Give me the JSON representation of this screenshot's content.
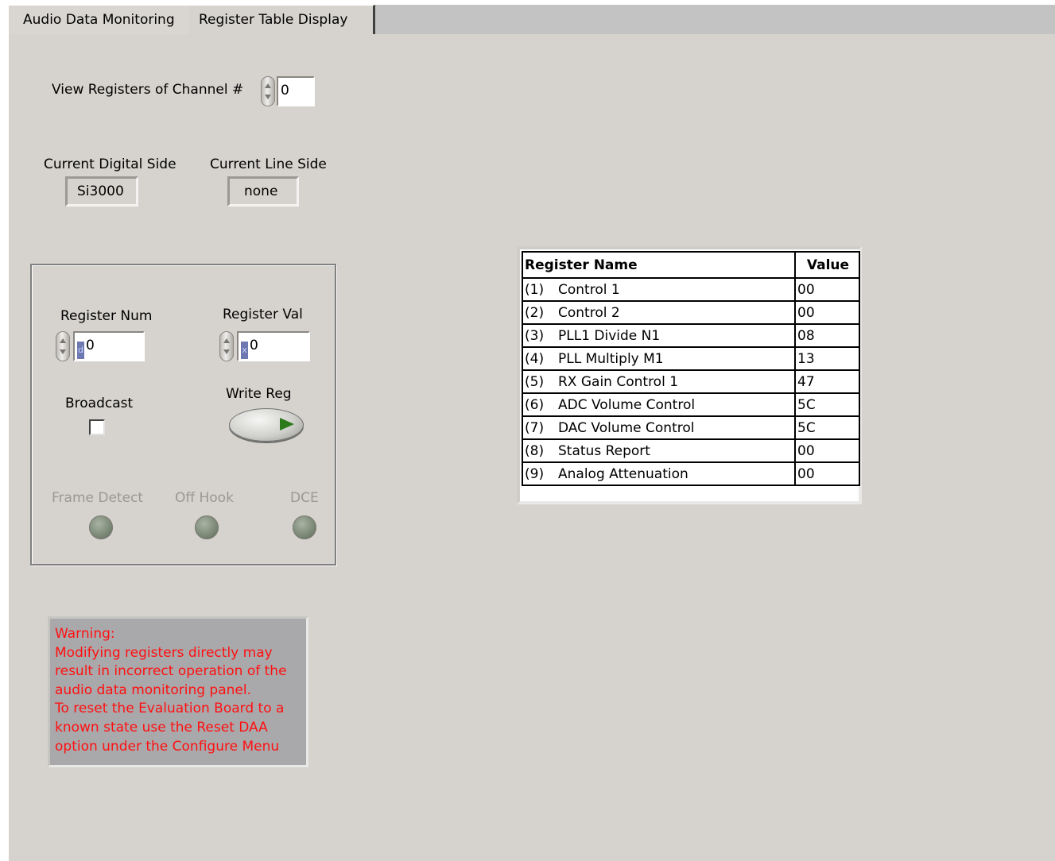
{
  "tabs": [
    {
      "label": "Audio Data Monitoring"
    },
    {
      "label": "Register Table Display"
    }
  ],
  "channel": {
    "label": "View Registers of Channel #",
    "value": "0"
  },
  "current_digital_side": {
    "label": "Current Digital Side",
    "value": "Si3000"
  },
  "current_line_side": {
    "label": "Current Line Side",
    "value": "none"
  },
  "register_num": {
    "label": "Register Num",
    "radix": "d",
    "value": "0"
  },
  "register_val": {
    "label": "Register Val",
    "radix": "x",
    "value": "0"
  },
  "broadcast": {
    "label": "Broadcast",
    "checked": false
  },
  "write_reg": {
    "label": "Write Reg"
  },
  "leds": [
    {
      "label": "Frame Detect"
    },
    {
      "label": "Off Hook"
    },
    {
      "label": "DCE"
    }
  ],
  "warning": {
    "lines": [
      "Warning:",
      "Modifying registers directly may",
      "result in incorrect operation of the",
      "audio data monitoring panel.",
      "To reset the Evaluation Board to a",
      "known state use the Reset DAA",
      "option under the Configure Menu"
    ]
  },
  "register_table": {
    "headers": [
      "Register Name",
      "Value"
    ],
    "rows": [
      {
        "num": "(1)",
        "name": "Control 1",
        "value": "00"
      },
      {
        "num": "(2)",
        "name": "Control 2",
        "value": "00"
      },
      {
        "num": "(3)",
        "name": "PLL1 Divide N1",
        "value": "08"
      },
      {
        "num": "(4)",
        "name": "PLL Multiply M1",
        "value": "13"
      },
      {
        "num": "(5)",
        "name": "RX Gain Control 1",
        "value": "47"
      },
      {
        "num": "(6)",
        "name": "ADC Volume Control",
        "value": "5C"
      },
      {
        "num": "(7)",
        "name": "DAC Volume Control",
        "value": "5C"
      },
      {
        "num": "(8)",
        "name": "Status Report",
        "value": "00"
      },
      {
        "num": "(9)",
        "name": "Analog Attenuation",
        "value": "00"
      }
    ]
  },
  "colors": {
    "warning_text": "#ff1010",
    "panel": "#d6d3ce",
    "led_off": "#7d8a77",
    "write_arrow": "#2d7a1b"
  }
}
